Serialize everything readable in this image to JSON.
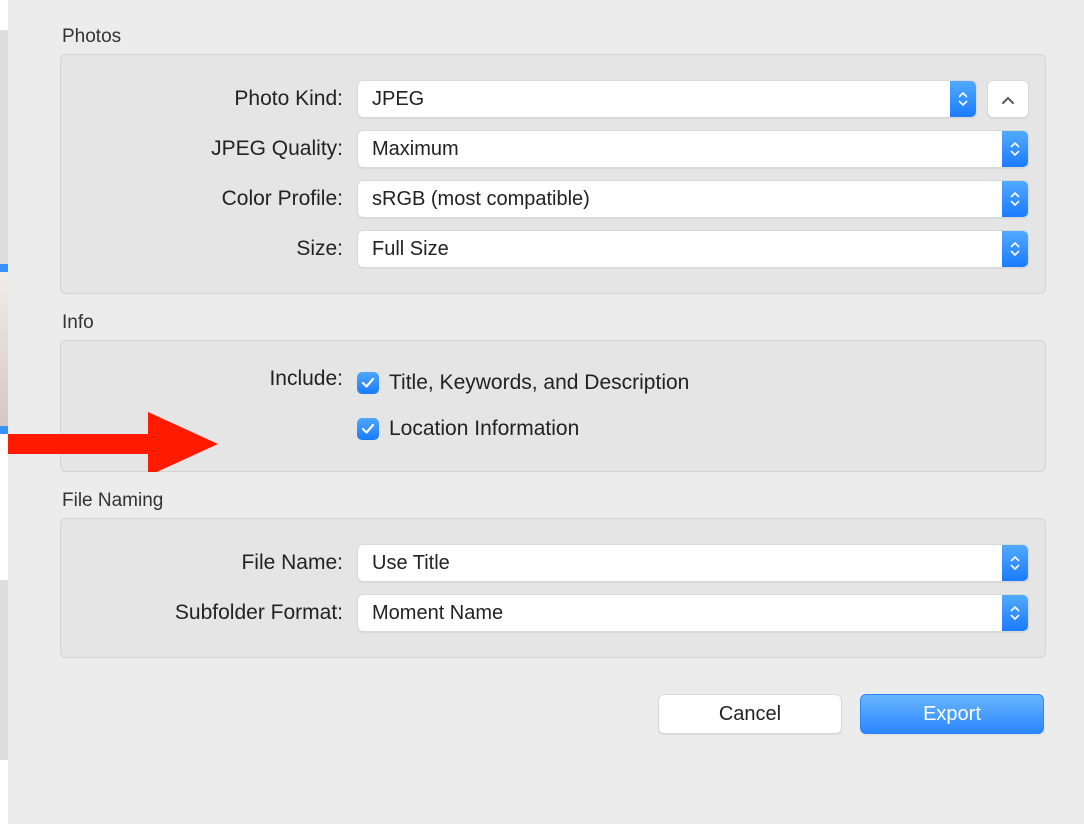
{
  "sections": {
    "photos": {
      "title": "Photos",
      "photo_kind_label": "Photo Kind:",
      "photo_kind_value": "JPEG",
      "jpeg_quality_label": "JPEG Quality:",
      "jpeg_quality_value": "Maximum",
      "color_profile_label": "Color Profile:",
      "color_profile_value": "sRGB (most compatible)",
      "size_label": "Size:",
      "size_value": "Full Size"
    },
    "info": {
      "title": "Info",
      "include_label": "Include:",
      "checkbox_title_keywords": "Title, Keywords, and Description",
      "checkbox_location": "Location Information"
    },
    "filenaming": {
      "title": "File Naming",
      "filename_label": "File Name:",
      "filename_value": "Use Title",
      "subfolder_label": "Subfolder Format:",
      "subfolder_value": "Moment Name"
    }
  },
  "buttons": {
    "cancel": "Cancel",
    "export": "Export"
  },
  "annotation": {
    "arrow_color": "#ff1a00"
  }
}
